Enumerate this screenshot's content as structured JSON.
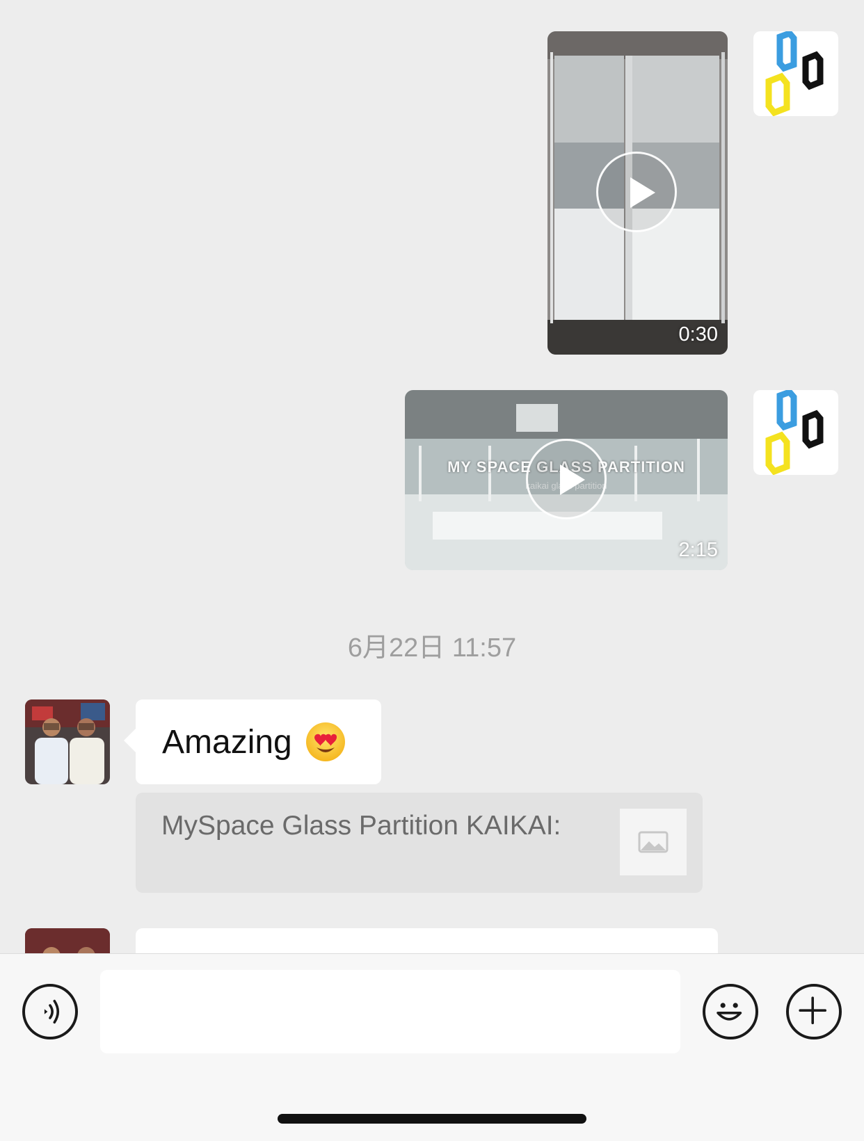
{
  "messages": {
    "video_1": {
      "duration": "0:30"
    },
    "video_2": {
      "duration": "2:15",
      "title_overlay": "MY SPACE GLASS PARTITION",
      "subtitle_overlay": "kaikai glass partition"
    },
    "timestamp": "6月22日 11:57",
    "text_message": {
      "text": "Amazing",
      "emoji": "smiling-face-with-heart-eyes"
    },
    "quote": {
      "text": "MySpace Glass Partition KAIKAI:"
    }
  },
  "input_bar": {
    "placeholder": ""
  },
  "colors": {
    "chat_background": "#ededed",
    "bubble_background": "#ffffff",
    "quote_background": "#e2e2e2",
    "logo_blue": "#3b9de0",
    "logo_yellow": "#f4e21f",
    "logo_black": "#111111"
  }
}
